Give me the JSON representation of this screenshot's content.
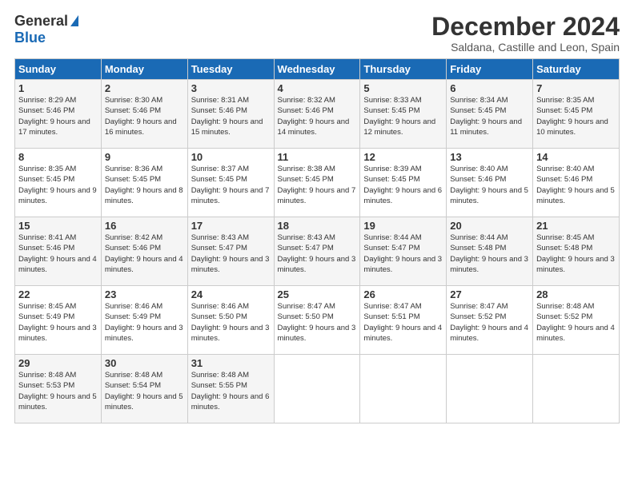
{
  "logo": {
    "general": "General",
    "blue": "Blue"
  },
  "header": {
    "month": "December 2024",
    "location": "Saldana, Castille and Leon, Spain"
  },
  "weekdays": [
    "Sunday",
    "Monday",
    "Tuesday",
    "Wednesday",
    "Thursday",
    "Friday",
    "Saturday"
  ],
  "weeks": [
    [
      {
        "day": "1",
        "sunrise": "8:29 AM",
        "sunset": "5:46 PM",
        "daylight": "9 hours and 17 minutes."
      },
      {
        "day": "2",
        "sunrise": "8:30 AM",
        "sunset": "5:46 PM",
        "daylight": "9 hours and 16 minutes."
      },
      {
        "day": "3",
        "sunrise": "8:31 AM",
        "sunset": "5:46 PM",
        "daylight": "9 hours and 15 minutes."
      },
      {
        "day": "4",
        "sunrise": "8:32 AM",
        "sunset": "5:46 PM",
        "daylight": "9 hours and 14 minutes."
      },
      {
        "day": "5",
        "sunrise": "8:33 AM",
        "sunset": "5:45 PM",
        "daylight": "9 hours and 12 minutes."
      },
      {
        "day": "6",
        "sunrise": "8:34 AM",
        "sunset": "5:45 PM",
        "daylight": "9 hours and 11 minutes."
      },
      {
        "day": "7",
        "sunrise": "8:35 AM",
        "sunset": "5:45 PM",
        "daylight": "9 hours and 10 minutes."
      }
    ],
    [
      {
        "day": "8",
        "sunrise": "8:35 AM",
        "sunset": "5:45 PM",
        "daylight": "9 hours and 9 minutes."
      },
      {
        "day": "9",
        "sunrise": "8:36 AM",
        "sunset": "5:45 PM",
        "daylight": "9 hours and 8 minutes."
      },
      {
        "day": "10",
        "sunrise": "8:37 AM",
        "sunset": "5:45 PM",
        "daylight": "9 hours and 7 minutes."
      },
      {
        "day": "11",
        "sunrise": "8:38 AM",
        "sunset": "5:45 PM",
        "daylight": "9 hours and 7 minutes."
      },
      {
        "day": "12",
        "sunrise": "8:39 AM",
        "sunset": "5:45 PM",
        "daylight": "9 hours and 6 minutes."
      },
      {
        "day": "13",
        "sunrise": "8:40 AM",
        "sunset": "5:46 PM",
        "daylight": "9 hours and 5 minutes."
      },
      {
        "day": "14",
        "sunrise": "8:40 AM",
        "sunset": "5:46 PM",
        "daylight": "9 hours and 5 minutes."
      }
    ],
    [
      {
        "day": "15",
        "sunrise": "8:41 AM",
        "sunset": "5:46 PM",
        "daylight": "9 hours and 4 minutes."
      },
      {
        "day": "16",
        "sunrise": "8:42 AM",
        "sunset": "5:46 PM",
        "daylight": "9 hours and 4 minutes."
      },
      {
        "day": "17",
        "sunrise": "8:43 AM",
        "sunset": "5:47 PM",
        "daylight": "9 hours and 3 minutes."
      },
      {
        "day": "18",
        "sunrise": "8:43 AM",
        "sunset": "5:47 PM",
        "daylight": "9 hours and 3 minutes."
      },
      {
        "day": "19",
        "sunrise": "8:44 AM",
        "sunset": "5:47 PM",
        "daylight": "9 hours and 3 minutes."
      },
      {
        "day": "20",
        "sunrise": "8:44 AM",
        "sunset": "5:48 PM",
        "daylight": "9 hours and 3 minutes."
      },
      {
        "day": "21",
        "sunrise": "8:45 AM",
        "sunset": "5:48 PM",
        "daylight": "9 hours and 3 minutes."
      }
    ],
    [
      {
        "day": "22",
        "sunrise": "8:45 AM",
        "sunset": "5:49 PM",
        "daylight": "9 hours and 3 minutes."
      },
      {
        "day": "23",
        "sunrise": "8:46 AM",
        "sunset": "5:49 PM",
        "daylight": "9 hours and 3 minutes."
      },
      {
        "day": "24",
        "sunrise": "8:46 AM",
        "sunset": "5:50 PM",
        "daylight": "9 hours and 3 minutes."
      },
      {
        "day": "25",
        "sunrise": "8:47 AM",
        "sunset": "5:50 PM",
        "daylight": "9 hours and 3 minutes."
      },
      {
        "day": "26",
        "sunrise": "8:47 AM",
        "sunset": "5:51 PM",
        "daylight": "9 hours and 4 minutes."
      },
      {
        "day": "27",
        "sunrise": "8:47 AM",
        "sunset": "5:52 PM",
        "daylight": "9 hours and 4 minutes."
      },
      {
        "day": "28",
        "sunrise": "8:48 AM",
        "sunset": "5:52 PM",
        "daylight": "9 hours and 4 minutes."
      }
    ],
    [
      {
        "day": "29",
        "sunrise": "8:48 AM",
        "sunset": "5:53 PM",
        "daylight": "9 hours and 5 minutes."
      },
      {
        "day": "30",
        "sunrise": "8:48 AM",
        "sunset": "5:54 PM",
        "daylight": "9 hours and 5 minutes."
      },
      {
        "day": "31",
        "sunrise": "8:48 AM",
        "sunset": "5:55 PM",
        "daylight": "9 hours and 6 minutes."
      },
      null,
      null,
      null,
      null
    ]
  ]
}
